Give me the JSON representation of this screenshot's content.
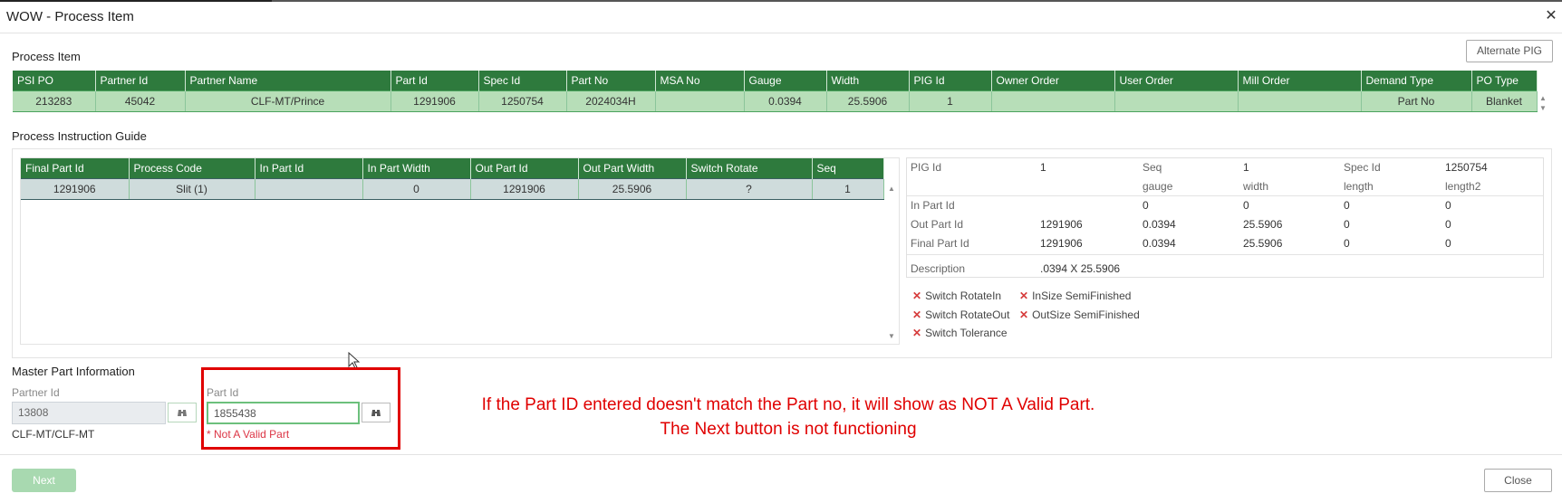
{
  "window": {
    "title": "WOW - Process Item"
  },
  "process_item": {
    "section_title": "Process Item",
    "alternate_pig_label": "Alternate PIG",
    "columns": [
      "PSI PO",
      "Partner Id",
      "Partner Name",
      "Part Id",
      "Spec Id",
      "Part No",
      "MSA No",
      "Gauge",
      "Width",
      "PIG Id",
      "Owner Order",
      "User Order",
      "Mill Order",
      "Demand Type",
      "PO Type"
    ],
    "row": [
      "213283",
      "45042",
      "CLF-MT/Prince",
      "1291906",
      "1250754",
      "2024034H",
      "",
      "0.0394",
      "25.5906",
      "1",
      "",
      "",
      "",
      "Part No",
      "Blanket"
    ]
  },
  "pig": {
    "section_title": "Process Instruction Guide",
    "columns": [
      "Final Part Id",
      "Process Code",
      "In Part Id",
      "In Part Width",
      "Out Part Id",
      "Out Part Width",
      "Switch Rotate",
      "Seq"
    ],
    "row": [
      "1291906",
      "Slit (1)",
      "",
      "0",
      "1291906",
      "25.5906",
      "?",
      "1"
    ]
  },
  "detail": {
    "pig_id_label": "PIG Id",
    "pig_id": "1",
    "seq_label": "Seq",
    "seq": "1",
    "spec_id_label": "Spec Id",
    "spec_id": "1250754",
    "col_headers": [
      "gauge",
      "width",
      "length",
      "length2"
    ],
    "rows": [
      {
        "label": "In Part Id",
        "part": "",
        "values": [
          "0",
          "0",
          "0",
          "0"
        ]
      },
      {
        "label": "Out Part Id",
        "part": "1291906",
        "values": [
          "0.0394",
          "25.5906",
          "0",
          "0"
        ]
      },
      {
        "label": "Final Part Id",
        "part": "1291906",
        "values": [
          "0.0394",
          "25.5906",
          "0",
          "0"
        ]
      }
    ],
    "description_label": "Description",
    "description": ".0394 X 25.5906",
    "flags": [
      "Switch RotateIn",
      "InSize SemiFinished",
      "Switch RotateOut",
      "OutSize SemiFinished",
      "Switch Tolerance"
    ]
  },
  "master": {
    "section_title": "Master Part Information",
    "partner_id_label": "Partner Id",
    "partner_id_value": "13808",
    "partner_name": "CLF-MT/CLF-MT",
    "part_id_label": "Part Id",
    "part_id_value": "1855438",
    "error": "* Not A Valid Part"
  },
  "annotation": {
    "line1": "If the Part ID entered doesn't match the Part no, it will show as NOT A Valid Part.",
    "line2": "The Next button is not functioning"
  },
  "footer": {
    "next_label": "Next",
    "close_label": "Close"
  },
  "colors": {
    "grid_header": "#2e7a3d",
    "selected_row": "#b7deb8",
    "pig_header": "#5d8b8f",
    "error": "#e00000",
    "next_disabled": "#a8d9b0"
  }
}
